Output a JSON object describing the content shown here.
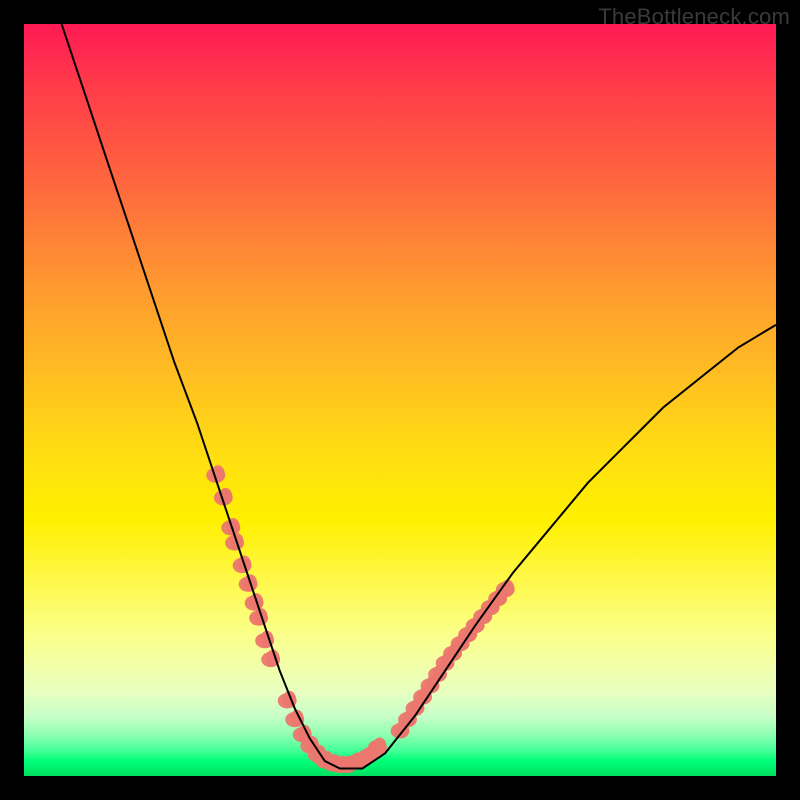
{
  "watermark": "TheBottleneck.com",
  "chart_data": {
    "type": "line",
    "title": "",
    "xlabel": "",
    "ylabel": "",
    "xlim": [
      0,
      100
    ],
    "ylim": [
      0,
      100
    ],
    "grid": false,
    "legend": false,
    "background_gradient": {
      "top": "#ff1a55",
      "mid": "#fff000",
      "bottom": "#00e060"
    },
    "series": [
      {
        "name": "bottleneck-curve",
        "color": "#000000",
        "stroke_width": 2,
        "x": [
          5,
          8,
          11,
          14,
          17,
          20,
          23,
          26,
          28,
          30,
          32,
          34,
          36,
          38,
          40,
          42,
          45,
          48,
          52,
          56,
          60,
          65,
          70,
          75,
          80,
          85,
          90,
          95,
          100
        ],
        "values": [
          100,
          91,
          82,
          73,
          64,
          55,
          47,
          38,
          32,
          26,
          20,
          14,
          9,
          5,
          2,
          1,
          1,
          3,
          8,
          14,
          20,
          27,
          33,
          39,
          44,
          49,
          53,
          57,
          60
        ]
      },
      {
        "name": "marker-cluster-left",
        "type": "scatter",
        "color": "#ec776e",
        "marker_shape": "blob",
        "marker_size": 9,
        "x": [
          25.5,
          26.5,
          27.5,
          28,
          29,
          29.8,
          30.6,
          31.2,
          32,
          32.8
        ],
        "values": [
          40,
          37,
          33,
          31,
          28,
          25.5,
          23,
          21,
          18,
          15.5
        ]
      },
      {
        "name": "marker-cluster-bottom",
        "type": "scatter",
        "color": "#ec776e",
        "marker_shape": "blob",
        "marker_size": 9,
        "x": [
          35,
          36,
          37,
          38,
          39,
          40,
          41,
          42,
          43,
          44,
          45,
          46,
          47
        ],
        "values": [
          10,
          7.5,
          5.5,
          4,
          2.8,
          2,
          1.6,
          1.4,
          1.4,
          1.8,
          2.2,
          2.8,
          3.8
        ]
      },
      {
        "name": "marker-cluster-right",
        "type": "scatter",
        "color": "#ec776e",
        "marker_shape": "blob",
        "marker_size": 9,
        "x": [
          50,
          51,
          52,
          53,
          54,
          55,
          56,
          57,
          58,
          59,
          60,
          61,
          62,
          63,
          64
        ],
        "values": [
          6,
          7.5,
          9,
          10.5,
          12,
          13.5,
          15,
          16.3,
          17.6,
          18.8,
          20,
          21.2,
          22.4,
          23.6,
          24.8
        ]
      }
    ]
  }
}
